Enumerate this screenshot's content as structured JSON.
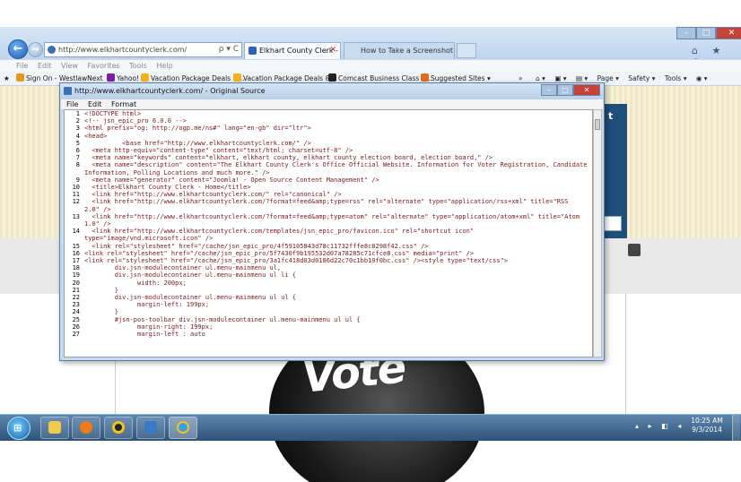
{
  "browser": {
    "address": "http://www.elkhartcountyclerk.com/",
    "address_tools": "ρ ▾ C",
    "tabs": [
      {
        "label": "Elkhart County Clerk - Home"
      },
      {
        "label": "How to Take a Screenshot Usin..."
      }
    ],
    "right_icons": "⌂ ★ ⚙",
    "window_controls": {
      "min": "–",
      "max": "□",
      "close": "✕"
    },
    "menu": [
      "File",
      "Edit",
      "View",
      "Favorites",
      "Tools",
      "Help"
    ],
    "favorites": [
      {
        "label": "Sign On - WestlawNext",
        "color": "#e39a1c"
      },
      {
        "label": "Yahoo!",
        "color": "#7a1fa2"
      },
      {
        "label": "Vacation Package Deals &...",
        "color": "#f2b31b"
      },
      {
        "label": "Vacation Package Deals &...",
        "color": "#f2b31b"
      },
      {
        "label": "Comcast Business Class - ...",
        "color": "#222222"
      },
      {
        "label": "Suggested Sites ▾",
        "color": "#e36b1c"
      }
    ],
    "favorites_overflow": "»",
    "command_bar": [
      "Page ▾",
      "Safety ▾",
      "Tools ▾"
    ]
  },
  "site": {
    "twitter": "t",
    "vote_text": "Vote"
  },
  "source_window": {
    "title": "http://www.elkhartcountyclerk.com/ - Original Source",
    "menu": [
      "File",
      "Edit",
      "Format"
    ],
    "lines": [
      {
        "n": "1",
        "t": "<!DOCTYPE html>"
      },
      {
        "n": "2",
        "t": "<!-- jsn_epic_pro 6.0.0 -->"
      },
      {
        "n": "3",
        "t": "<html prefix=\"og: http://ogp.me/ns#\" lang=\"en-gb\" dir=\"ltr\">"
      },
      {
        "n": "4",
        "t": "<head>"
      },
      {
        "n": "5",
        "t": "          <base href=\"http://www.elkhartcountyclerk.com/\" />"
      },
      {
        "n": "6",
        "t": "  <meta http-equiv=\"content-type\" content=\"text/html; charset=utf-8\" />"
      },
      {
        "n": "7",
        "t": "  <meta name=\"keywords\" content=\"elkhart, elkhart county, elkhart county election board, election board,\" />"
      },
      {
        "n": "8",
        "t": "  <meta name=\"description\" content=\"The Elkhart County Clerk's Office Official Website. Information for Voter Registration, Candidate"
      },
      {
        "n": "",
        "t": "Information, Polling Locations and much more.\" />"
      },
      {
        "n": "9",
        "t": "  <meta name=\"generator\" content=\"Joomla! - Open Source Content Management\" />"
      },
      {
        "n": "10",
        "t": "  <title>Elkhart County Clerk - Home</title>"
      },
      {
        "n": "11",
        "t": "  <link href=\"http://www.elkhartcountyclerk.com/\" rel=\"canonical\" />"
      },
      {
        "n": "12",
        "t": "  <link href=\"http://www.elkhartcountyclerk.com/?format=feed&amp;type=rss\" rel=\"alternate\" type=\"application/rss+xml\" title=\"RSS"
      },
      {
        "n": "",
        "t": "2.0\" />"
      },
      {
        "n": "13",
        "t": "  <link href=\"http://www.elkhartcountyclerk.com/?format=feed&amp;type=atom\" rel=\"alternate\" type=\"application/atom+xml\" title=\"Atom"
      },
      {
        "n": "",
        "t": "1.0\" />"
      },
      {
        "n": "14",
        "t": "  <link href=\"http://www.elkhartcountyclerk.com/templates/jsn_epic_pro/favicon.ico\" rel=\"shortcut icon\""
      },
      {
        "n": "",
        "t": "type=\"image/vnd.microsoft.icon\" />"
      },
      {
        "n": "15",
        "t": "  <link rel=\"stylesheet\" href=\"/cache/jsn_epic_pro/4f59105843d78c11732fffe8c8298f42.css\" />"
      },
      {
        "n": "16",
        "t": "<link rel=\"stylesheet\" href=\"/cache/jsn_epic_pro/5f7430f9b195532d07a78285c71cfce8.css\" media=\"print\" />"
      },
      {
        "n": "17",
        "t": "<link rel=\"stylesheet\" href=\"/cache/jsn_epic_pro/3a1fc418d03d0186d22c70c1bb10f0bc.css\" /><style type=\"text/css\">"
      },
      {
        "n": "18",
        "t": "        div.jsn-modulecontainer ul.menu-mainmenu ul,"
      },
      {
        "n": "19",
        "t": "        div.jsn-modulecontainer ul.menu-mainmenu ul li {"
      },
      {
        "n": "20",
        "t": "              width: 200px;"
      },
      {
        "n": "21",
        "t": "        }"
      },
      {
        "n": "22",
        "t": "        div.jsn-modulecontainer ul.menu-mainmenu ul ul {"
      },
      {
        "n": "23",
        "t": "              margin-left: 199px;"
      },
      {
        "n": "24",
        "t": "        }"
      },
      {
        "n": "25",
        "t": "        #jsn-pos-toolbar div.jsn-modulecontainer ul.menu-mainmenu ul ul {"
      },
      {
        "n": "26",
        "t": "              margin-right: 199px;"
      },
      {
        "n": "27",
        "t": "              margin-left : auto"
      }
    ]
  },
  "taskbar": {
    "start": "⊞",
    "tray": "▴ ▸ ◧ ◂",
    "time": "10:25 AM",
    "date": "9/3/2014"
  }
}
